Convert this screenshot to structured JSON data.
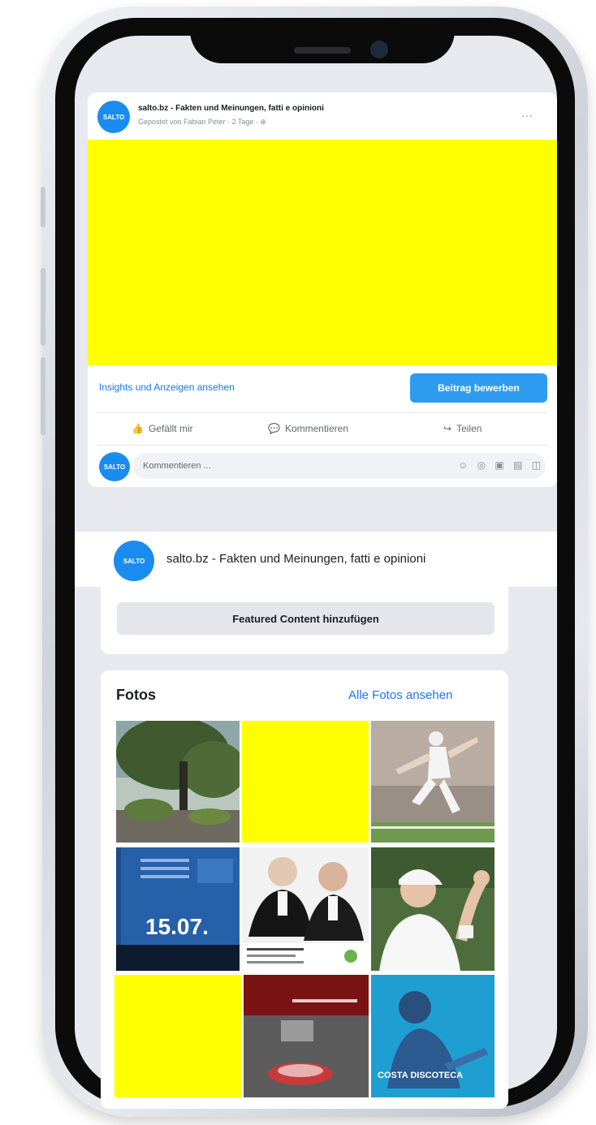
{
  "post": {
    "page_name": "salto.bz - Fakten und Meinungen, fatti e opinioni",
    "subtitle": "Gepostet von Fabian Peter · 2 Tage · ⊕",
    "avatar_text": "SALTO",
    "more": "···",
    "insights_link": "Insights und Anzeigen ansehen",
    "promote_button": "Beitrag bewerben",
    "actions": [
      {
        "icon": "👍",
        "label": "Gefällt mir"
      },
      {
        "icon": "💬",
        "label": "Kommentieren"
      },
      {
        "icon": "↪",
        "label": "Teilen"
      }
    ],
    "comment_placeholder": "Kommentieren ...",
    "comment_icons": "☺ ◎ ▣ ▤ ◫"
  },
  "header": {
    "page_name": "salto.bz - Fakten und Meinungen, fatti e opinioni",
    "avatar_text": "SALTO"
  },
  "featured": {
    "button_label": "Featured Content hinzufügen"
  },
  "photos": {
    "title": "Fotos",
    "see_all": "Alle Fotos ansehen",
    "tile_texts": {
      "event_date": "15.07.",
      "music_caption": "COSTA DISCOTECA"
    }
  },
  "colors": {
    "accent": "#1877f2",
    "placeholder_yellow": "#ffff00"
  }
}
